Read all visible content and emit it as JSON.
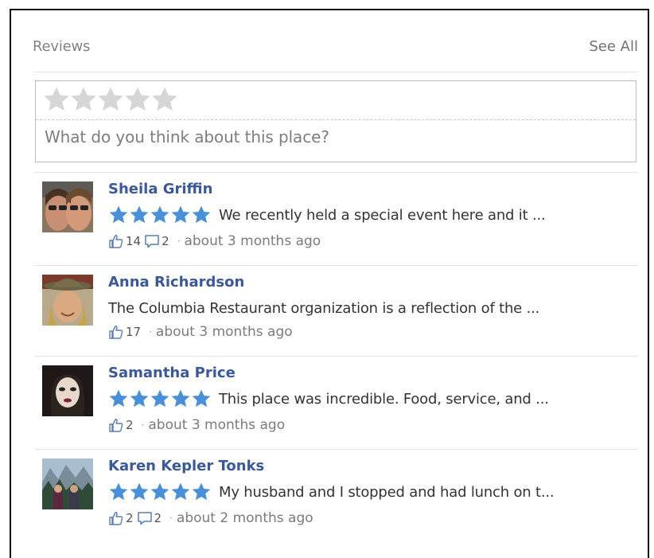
{
  "header": {
    "title": "Reviews",
    "see_all": "See All"
  },
  "composer": {
    "empty_stars": 5,
    "placeholder": "What do you think about this place?"
  },
  "colors": {
    "name_link": "#3b5998",
    "star_filled": "#4a90d9",
    "star_empty": "#d4d4d4"
  },
  "reviews": [
    {
      "name": "Sheila Griffin",
      "rating": 5,
      "text": "We recently held a special event here and it ...",
      "likes": "14",
      "comments": "2",
      "time": "about 3 months ago"
    },
    {
      "name": "Anna Richardson",
      "rating": 0,
      "text": "The Columbia Restaurant organization is a reflection of the ...",
      "likes": "17",
      "comments": "",
      "time": "about 3 months ago"
    },
    {
      "name": "Samantha Price",
      "rating": 5,
      "text": "This place was incredible. Food, service, and ...",
      "likes": "2",
      "comments": "",
      "time": "about 3 months ago"
    },
    {
      "name": "Karen Kepler Tonks",
      "rating": 5,
      "text": "My husband and I stopped and had lunch on t...",
      "likes": "2",
      "comments": "2",
      "time": "about 2 months ago"
    }
  ]
}
